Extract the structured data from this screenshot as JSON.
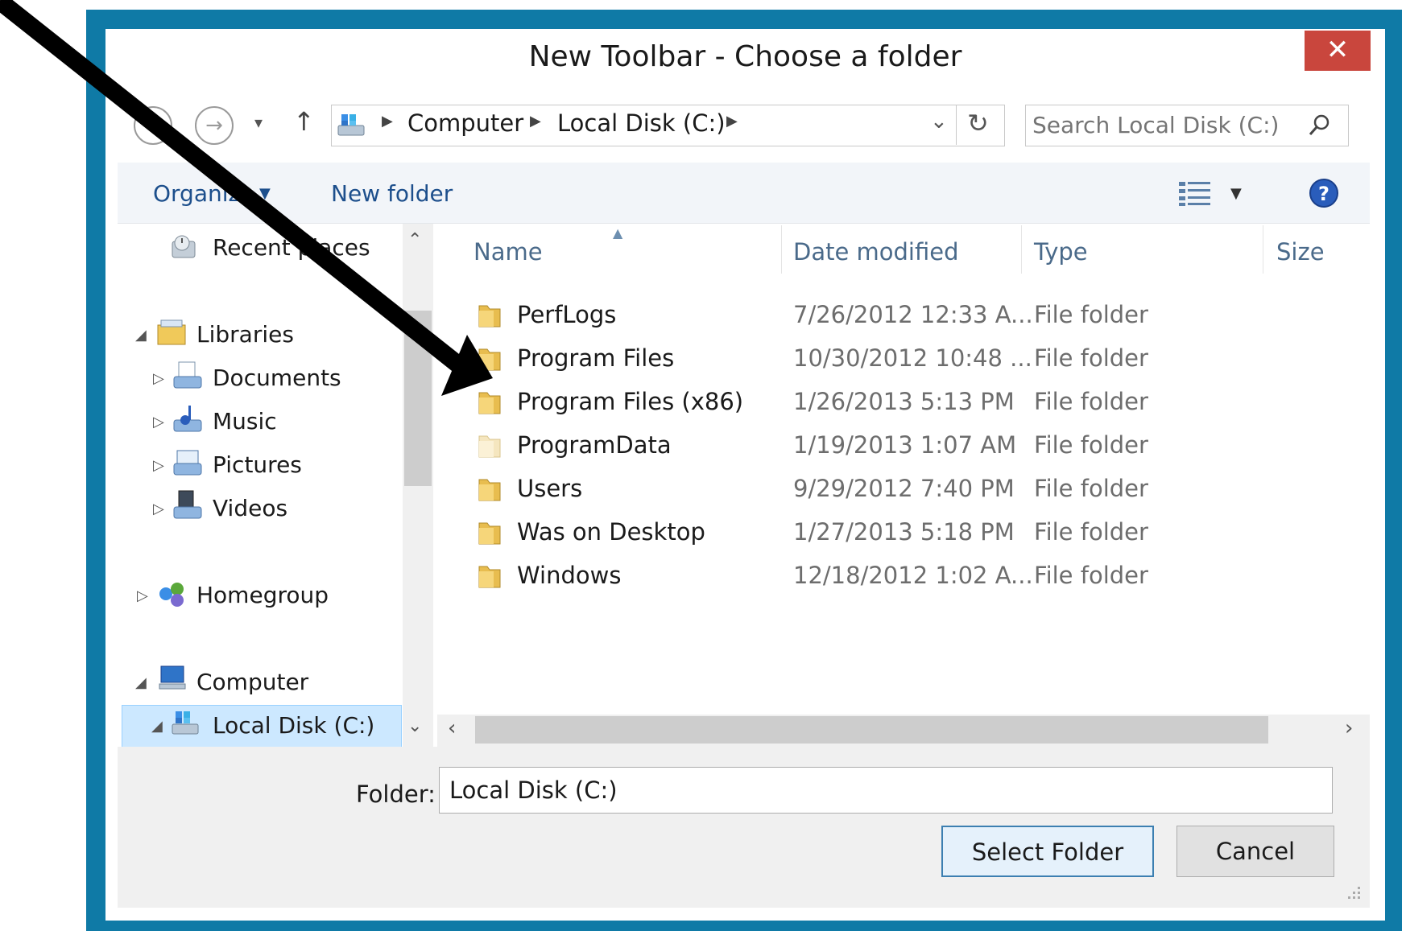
{
  "dialog": {
    "title": "New Toolbar - Choose a folder",
    "close_label": "✕"
  },
  "nav": {
    "breadcrumb": [
      "Computer",
      "Local Disk (C:)"
    ],
    "search_placeholder": "Search Local Disk (C:)"
  },
  "toolbar": {
    "organize_label": "Organize",
    "new_folder_label": "New folder"
  },
  "sidebar": {
    "recent_places": "Recent places",
    "libraries": "Libraries",
    "documents": "Documents",
    "music": "Music",
    "pictures": "Pictures",
    "videos": "Videos",
    "homegroup": "Homegroup",
    "computer": "Computer",
    "local_disk": "Local Disk (C:)"
  },
  "columns": {
    "name": "Name",
    "date": "Date modified",
    "type": "Type",
    "size": "Size"
  },
  "files": [
    {
      "name": "PerfLogs",
      "date": "7/26/2012 12:33 A...",
      "type": "File folder"
    },
    {
      "name": "Program Files",
      "date": "10/30/2012 10:48 ...",
      "type": "File folder"
    },
    {
      "name": "Program Files (x86)",
      "date": "1/26/2013 5:13 PM",
      "type": "File folder"
    },
    {
      "name": "ProgramData",
      "date": "1/19/2013 1:07 AM",
      "type": "File folder"
    },
    {
      "name": "Users",
      "date": "9/29/2012 7:40 PM",
      "type": "File folder"
    },
    {
      "name": "Was on Desktop",
      "date": "1/27/2013 5:18 PM",
      "type": "File folder"
    },
    {
      "name": "Windows",
      "date": "12/18/2012 1:02 A...",
      "type": "File folder"
    }
  ],
  "footer": {
    "folder_label": "Folder:",
    "folder_value": "Local Disk (C:)",
    "select_label": "Select Folder",
    "cancel_label": "Cancel"
  },
  "colors": {
    "frame": "#0f7aa6",
    "close": "#c9463d",
    "selection": "#cce8ff",
    "link": "#1d4f8c"
  }
}
